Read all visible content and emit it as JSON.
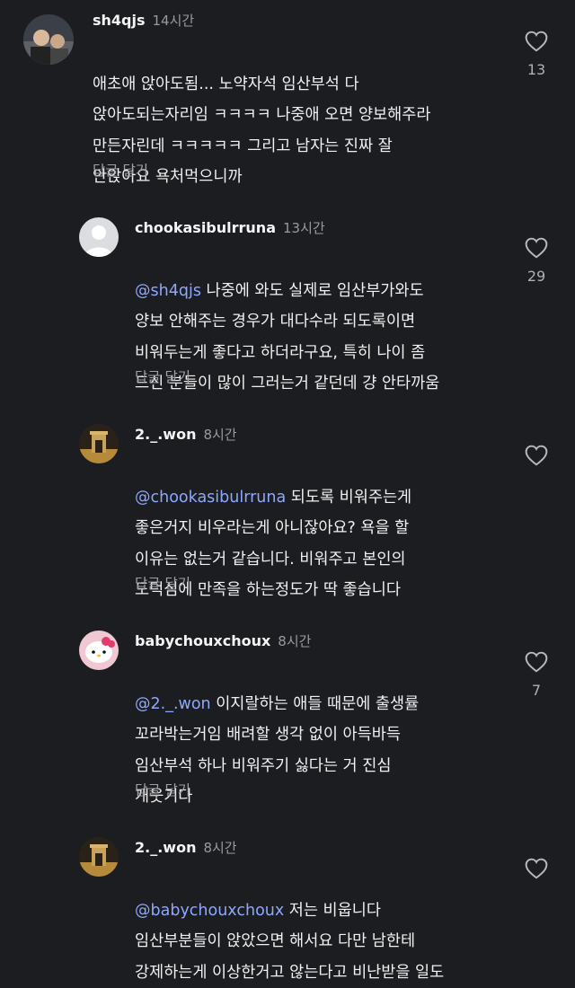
{
  "reply_label": "답글 달기",
  "comments": [
    {
      "username": "sh4qjs",
      "time": "14시간",
      "mention": "",
      "text": "애초애 앉아도됨... 노약자석 임산부석 다\n앉아도되는자리임 ㅋㅋㅋㅋ 나중애 오면 양보해주라\n만든자린데 ㅋㅋㅋㅋㅋ 그리고 남자는 진짜 잘\n안앉아요 욕처먹으니까",
      "likes": "13"
    },
    {
      "username": "chookasibulrruna",
      "time": "13시간",
      "mention": "@sh4qjs",
      "text": " 나중에 와도 실제로 임산부가와도\n양보 안해주는 경우가 대다수라 되도록이면\n비워두는게 좋다고 하더라구요, 특히 나이 좀\n드신 분들이 많이 그러는거 같던데 걍 안타까움",
      "likes": "29"
    },
    {
      "username": "2._.won",
      "time": "8시간",
      "mention": "@chookasibulrruna",
      "text": " 되도록 비워주는게\n좋은거지 비우라는게 아니잖아요? 욕을 할\n이유는 없는거 같습니다. 비워주고 본인의\n도덕심에 만족을 하는정도가 딱 좋습니다",
      "likes": ""
    },
    {
      "username": "babychouxchoux",
      "time": "8시간",
      "mention": "@2._.won",
      "text": " 이지랄하는 애들 때문에 출생률\n꼬라박는거임 배려할 생각 없이 아득바득\n임산부석 하나 비워주기 싫다는 거 진심\n개웃기다",
      "likes": "7"
    },
    {
      "username": "2._.won",
      "time": "8시간",
      "mention": "@babychouxchoux",
      "text": " 저는 비웁니다\n임산부분들이 앉았으면 해서요 다만 남한테\n강제하는게 이상한거고 않는다고 비난받을 일도",
      "likes": ""
    }
  ]
}
